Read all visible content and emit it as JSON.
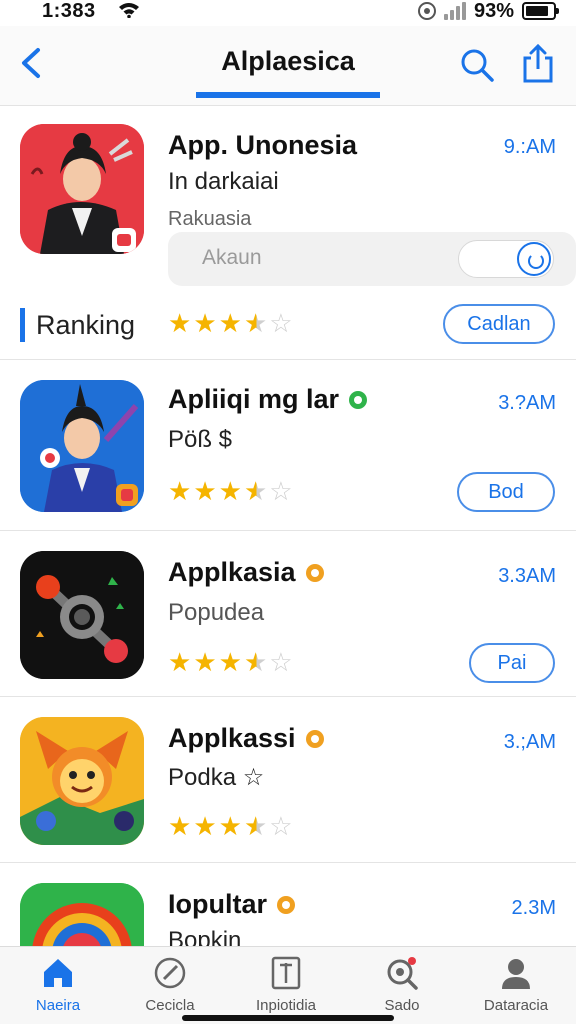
{
  "status_bar": {
    "time": "1:383",
    "battery_pct": "93%",
    "battery_level": 0.85,
    "icons": [
      "wifi-icon",
      "location-ring-icon",
      "signal-icon",
      "battery-icon"
    ]
  },
  "nav": {
    "title": "Alplaesica",
    "icons": [
      "chevron-left-icon",
      "search-icon",
      "share-icon"
    ],
    "accent": "#1a73e8"
  },
  "apps": [
    {
      "name": "App. Unonesia",
      "subtitle": "In darkaiai",
      "meta": "Rakuasia",
      "size": "9.:AM",
      "toggle_label": "Akaun",
      "ranking_label": "Ranking",
      "rating": 3.5,
      "button": "Cadlan",
      "icon_bg": "#e63a43"
    },
    {
      "name": "Apliiqi mg lar",
      "subtitle": "Pöß $",
      "size": "3.?AM",
      "badge_color": "#2fb34a",
      "rating": 3.5,
      "button": "Bod",
      "icon_bg": "#1f6fd6"
    },
    {
      "name": "Applkasia",
      "subtitle": "Popudea",
      "size": "3.3AM",
      "badge_color": "#f0a020",
      "rating": 3.5,
      "button": "Pai",
      "icon_bg": "#111111"
    },
    {
      "name": "Applkassi",
      "subtitle": "Podka ☆",
      "size": "3.;AM",
      "badge_color": "#f0a020",
      "rating": 3.5,
      "button": "",
      "icon_bg": "#f4b321"
    },
    {
      "name": "Iopultar",
      "subtitle": "Bopkin",
      "size": "2.3M",
      "badge_color": "#f0a020",
      "icon_bg": "#2fb34a"
    }
  ],
  "tabs": [
    {
      "label": "Naeira",
      "icon": "home-icon",
      "active": true
    },
    {
      "label": "Cecicla",
      "icon": "compass-icon",
      "active": false
    },
    {
      "label": "Inpiotidia",
      "icon": "book-icon",
      "active": false
    },
    {
      "label": "Sado",
      "icon": "search-badge-icon",
      "active": false
    },
    {
      "label": "Dataracia",
      "icon": "profile-icon",
      "active": false
    }
  ]
}
